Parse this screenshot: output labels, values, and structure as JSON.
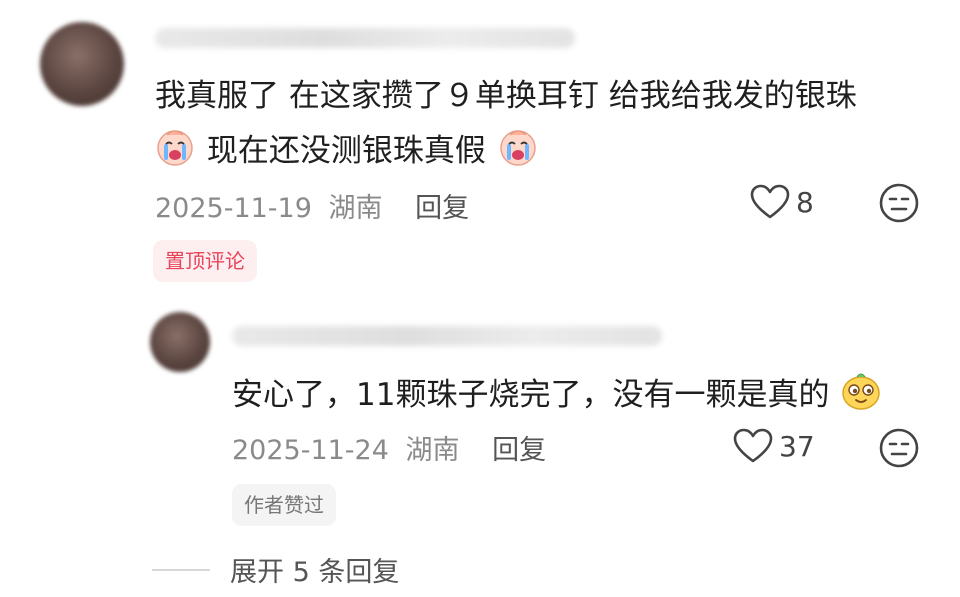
{
  "comment": {
    "text_line1": "我真服了 在这家攒了９单换耳钉 给我给我发的银珠",
    "text_line2": "现在还没测银珠真假",
    "emoji_icon": "crying-face-icon",
    "date": "2025-11-19",
    "location": "湖南",
    "reply_label": "回复",
    "like_count": "8",
    "badge": "置顶评论"
  },
  "reply_comment": {
    "text": "安心了，11颗珠子烧完了，没有一颗是真的",
    "emoji_icon": "smirk-face-icon",
    "date": "2025-11-24",
    "location": "湖南",
    "reply_label": "回复",
    "like_count": "37",
    "badge": "作者赞过"
  },
  "expand": {
    "label": "展开 5 条回复"
  },
  "colors": {
    "pin_badge_text": "#e8445a",
    "pin_badge_bg": "#fdeef0",
    "meta_text": "#8a8a8a"
  }
}
